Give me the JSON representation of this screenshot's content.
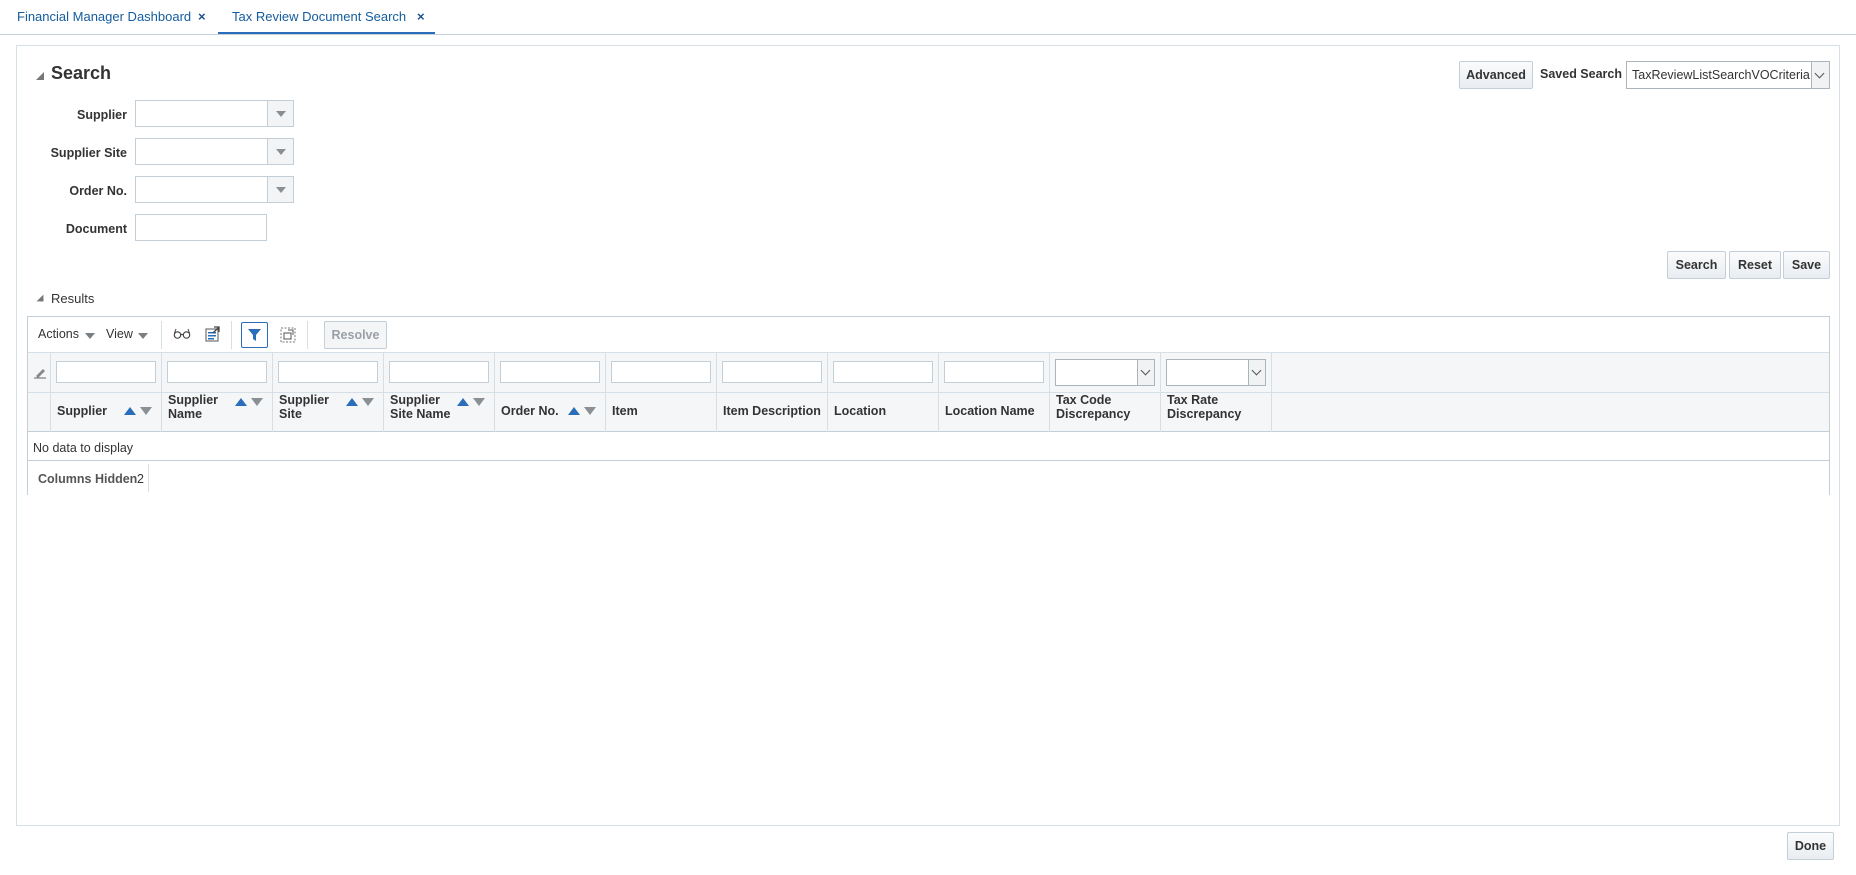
{
  "tabs": [
    {
      "label": "Financial Manager Dashboard",
      "close": "×"
    },
    {
      "label": "Tax Review Document Search",
      "close": "×"
    }
  ],
  "search": {
    "title": "Search",
    "advanced_label": "Advanced",
    "saved_search_label": "Saved Search",
    "saved_search_value": "TaxReviewListSearchVOCriteria",
    "fields": {
      "supplier_label": "Supplier",
      "supplier_site_label": "Supplier Site",
      "order_no_label": "Order No.",
      "document_label": "Document"
    },
    "buttons": {
      "search": "Search",
      "reset": "Reset",
      "save": "Save"
    }
  },
  "results": {
    "title": "Results",
    "actions_label": "Actions",
    "view_label": "View",
    "resolve_label": "Resolve",
    "columns": [
      {
        "line1": "Supplier",
        "line2": ""
      },
      {
        "line1": "Supplier",
        "line2": "Name"
      },
      {
        "line1": "Supplier",
        "line2": "Site"
      },
      {
        "line1": "Supplier",
        "line2": "Site Name"
      },
      {
        "line1": "Order No.",
        "line2": ""
      },
      {
        "line1": "Item",
        "line2": ""
      },
      {
        "line1": "Item Description",
        "line2": ""
      },
      {
        "line1": "Location",
        "line2": ""
      },
      {
        "line1": "Location Name",
        "line2": ""
      },
      {
        "line1": "Tax Code",
        "line2": "Discrepancy"
      },
      {
        "line1": "Tax Rate",
        "line2": "Discrepancy"
      }
    ],
    "no_data": "No data to display",
    "columns_hidden_label": "Columns Hidden",
    "columns_hidden_count": "2"
  },
  "done_label": "Done",
  "colors": {
    "accent": "#2a6ebb",
    "link": "#145c9e",
    "border": "#c4ced7"
  }
}
